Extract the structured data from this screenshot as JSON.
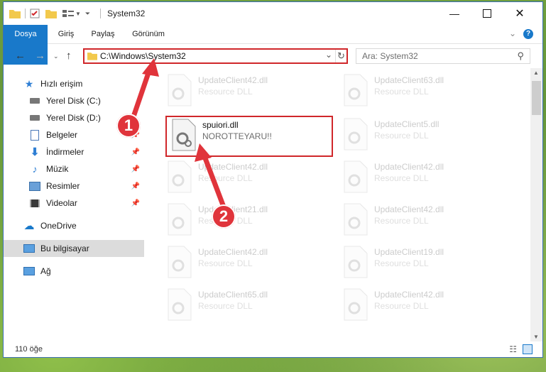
{
  "window": {
    "title": "System32"
  },
  "ribbon": {
    "tabs": [
      "Dosya",
      "Giriş",
      "Paylaş",
      "Görünüm"
    ]
  },
  "address": {
    "path": "C:\\Windows\\System32",
    "search_placeholder": "Ara: System32"
  },
  "sidebar": {
    "items": [
      {
        "label": "Hızlı erişim",
        "icon": "star-icon"
      },
      {
        "label": "Yerel Disk (C:)",
        "icon": "disk-icon"
      },
      {
        "label": "Yerel Disk (D:)",
        "icon": "disk-icon"
      },
      {
        "label": "Belgeler",
        "icon": "document-icon"
      },
      {
        "label": "İndirmeler",
        "icon": "download-icon"
      },
      {
        "label": "Müzik",
        "icon": "music-icon"
      },
      {
        "label": "Resimler",
        "icon": "pictures-icon"
      },
      {
        "label": "Videolar",
        "icon": "video-icon"
      },
      {
        "label": "OneDrive",
        "icon": "cloud-icon"
      },
      {
        "label": "Bu bilgisayar",
        "icon": "computer-icon"
      },
      {
        "label": "Ağ",
        "icon": "network-icon"
      }
    ]
  },
  "files": {
    "left": [
      {
        "name": "UpdateClient42.dll",
        "desc": "Resource DLL"
      },
      {
        "name": "spuiori.dll",
        "desc": "NOROTTEYARU!!"
      },
      {
        "name": "UpdateClient42.dll",
        "desc": "Resource DLL"
      },
      {
        "name": "UpdateClient21.dll",
        "desc": "Resource DLL"
      },
      {
        "name": "UpdateClient42.dll",
        "desc": "Resource DLL"
      },
      {
        "name": "UpdateClient65.dll",
        "desc": "Resource DLL"
      }
    ],
    "right": [
      {
        "name": "UpdateClient63.dll",
        "desc": "Resource DLL"
      },
      {
        "name": "UpdateClient5.dll",
        "desc": "Resource DLL"
      },
      {
        "name": "UpdateClient42.dll",
        "desc": "Resource DLL"
      },
      {
        "name": "UpdateClient42.dll",
        "desc": "Resource DLL"
      },
      {
        "name": "UpdateClient19.dll",
        "desc": "Resource DLL"
      },
      {
        "name": "UpdateClient42.dll",
        "desc": "Resource DLL"
      }
    ]
  },
  "status": {
    "count": "110 öğe"
  },
  "markers": {
    "one": "1",
    "two": "2"
  },
  "colors": {
    "accent": "#1979ca",
    "highlight": "#d0272a",
    "marker": "#e0343b"
  }
}
